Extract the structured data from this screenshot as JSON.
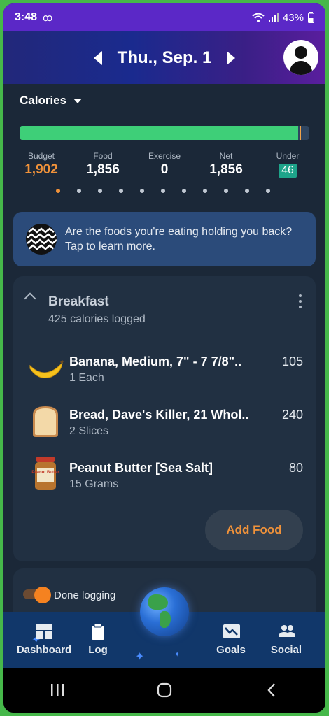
{
  "status_bar": {
    "time": "3:48",
    "voicemail_icon": "voicemail-icon",
    "battery": "43%"
  },
  "header": {
    "date": "Thu., Sep. 1"
  },
  "calories": {
    "title": "Calories",
    "budget_used_fraction": 0.9758,
    "stats": [
      {
        "label": "Budget",
        "value": "1,902"
      },
      {
        "label": "Food",
        "value": "1,856"
      },
      {
        "label": "Exercise",
        "value": "0"
      },
      {
        "label": "Net",
        "value": "1,856"
      },
      {
        "label": "Under",
        "value": "46"
      }
    ],
    "page_count": 11,
    "active_page": 0
  },
  "promo": {
    "text": "Are the foods you're eating holding you back? Tap to learn more."
  },
  "meal": {
    "name": "Breakfast",
    "subtitle": "425 calories logged",
    "items": [
      {
        "name": "Banana, Medium, 7\" - 7 7/8\"..",
        "qty": "1 Each",
        "calories": "105",
        "icon": "banana-icon"
      },
      {
        "name": "Bread, Dave's Killer, 21 Whol..",
        "qty": "2 Slices",
        "calories": "240",
        "icon": "bread-icon"
      },
      {
        "name": "Peanut Butter [Sea Salt]",
        "qty": "15 Grams",
        "calories": "80",
        "icon": "peanut-butter-jar-icon"
      }
    ],
    "add_food": "Add Food",
    "jar_label": "Peanut Butter"
  },
  "done_logging": {
    "label": "Done logging",
    "on": true
  },
  "tabs": [
    {
      "label": "Dashboard",
      "icon": "dashboard-icon"
    },
    {
      "label": "Log",
      "icon": "clipboard-icon"
    },
    {
      "label": "Goals",
      "icon": "chart-goals-icon"
    },
    {
      "label": "Social",
      "icon": "people-icon"
    }
  ],
  "colors": {
    "accent": "#f0923a",
    "progress": "#3ecf78",
    "under_badge": "#1ea48a"
  }
}
